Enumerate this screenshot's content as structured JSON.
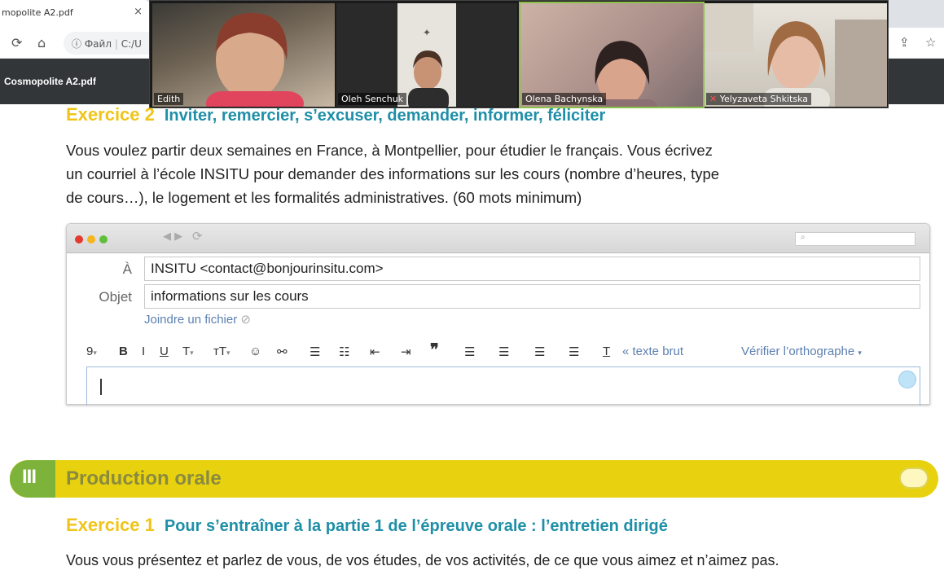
{
  "browser": {
    "tab_title": "mopolite A2.pdf",
    "tab_close": "×",
    "address_scheme": "Файл",
    "address_path": "C:/U",
    "icons": [
      "reload-icon",
      "home-icon",
      "info-icon",
      "share-icon",
      "star-icon"
    ]
  },
  "pdf_viewer": {
    "title": "Cosmopolite A2.pdf"
  },
  "video_call": {
    "participants": [
      {
        "name": "Edith",
        "muted": false
      },
      {
        "name": "Oleh Senchuk",
        "muted": false
      },
      {
        "name": "Olena Bachynska",
        "muted": false,
        "active": true
      },
      {
        "name": "Yelyzaveta Shkitska",
        "muted": true
      }
    ]
  },
  "exercise2": {
    "number": "Exercice 2",
    "heading": "Inviter, remercier, s’excuser, demander, informer, féliciter",
    "lines": [
      "Vous voulez partir deux semaines en France, à Montpellier, pour étudier le français. Vous écrivez",
      "un courriel à l’école INSITU pour demander des informations sur les cours (nombre d’heures, type",
      "de cours…), le logement et les formalités administratives. (60 mots minimum)"
    ]
  },
  "email": {
    "to_label": "À",
    "to_value": "INSITU <contact@bonjourinsitu.com>",
    "subject_label": "Objet",
    "subject_value": "informations sur les cours",
    "attach_label": "Joindre un fichier",
    "font_size": "9",
    "bold": "B",
    "italic": "I",
    "underline": "U",
    "text_color": "T",
    "text_size": "тT",
    "plain_text": "« texte brut",
    "spellcheck": "Vérifier l’orthographe"
  },
  "section": {
    "numeral": "III",
    "title": "Production orale"
  },
  "exercise1": {
    "number": "Exercice 1",
    "heading": "Pour s’entraîner à la partie 1 de l’épreuve orale : l’entretien dirigé",
    "text": "Vous vous présentez et parlez de vous, de vos études, de vos activités, de ce que vous aimez et n’aimez pas."
  },
  "colors": {
    "exercise_number": "#f0c419",
    "exercise_heading": "#1f8fa8",
    "banner": "#e8d20f",
    "banner_tab": "#7db33b",
    "active_speaker": "#8bc34a"
  }
}
